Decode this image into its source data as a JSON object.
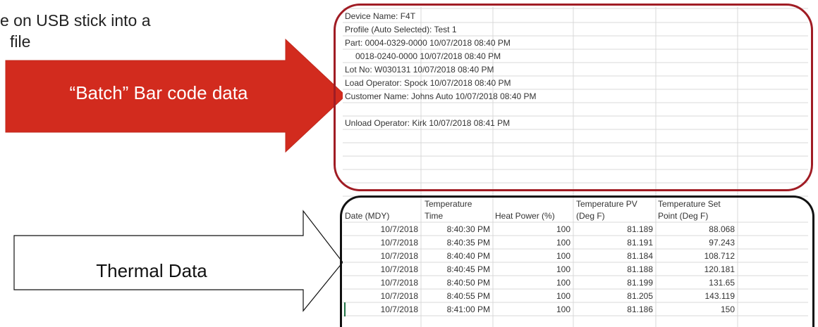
{
  "intro": {
    "line1": "e on USB stick into a",
    "line2": "file"
  },
  "arrows": {
    "batch_label": "“Batch” Bar code data",
    "thermal_label": "Thermal Data",
    "batch_color": "#d22b1e",
    "thermal_color": "#ffffff"
  },
  "batch_section": {
    "lines": [
      "Device Name: F4T",
      "Profile (Auto Selected): Test 1",
      "Part: 0004-0329-0000 10/07/2018 08:40 PM",
      "0018-0240-0000 10/07/2018 08:40 PM",
      "Lot No: W030131 10/07/2018 08:40 PM",
      "Load Operator: Spock 10/07/2018 08:40 PM",
      "Customer Name: Johns Auto 10/07/2018 08:40 PM",
      "",
      "Unload Operator: Kirk 10/07/2018 08:41 PM"
    ],
    "box_color": "#a01c24"
  },
  "thermal_section": {
    "headers": {
      "date": "Date (MDY)",
      "time": "Time",
      "heat_line1": "Temperature",
      "heat_line2": "Heat Power (%)",
      "pv_line1": "Temperature PV",
      "pv_line2": "(Deg F)",
      "sp_line1": "Temperature Set",
      "sp_line2": "Point (Deg F)"
    },
    "rows": [
      {
        "date": "10/7/2018",
        "time": "8:40:30 PM",
        "heat": "100",
        "pv": "81.189",
        "sp": "88.068"
      },
      {
        "date": "10/7/2018",
        "time": "8:40:35 PM",
        "heat": "100",
        "pv": "81.191",
        "sp": "97.243"
      },
      {
        "date": "10/7/2018",
        "time": "8:40:40 PM",
        "heat": "100",
        "pv": "81.184",
        "sp": "108.712"
      },
      {
        "date": "10/7/2018",
        "time": "8:40:45 PM",
        "heat": "100",
        "pv": "81.188",
        "sp": "120.181"
      },
      {
        "date": "10/7/2018",
        "time": "8:40:50 PM",
        "heat": "100",
        "pv": "81.199",
        "sp": "131.65"
      },
      {
        "date": "10/7/2018",
        "time": "8:40:55 PM",
        "heat": "100",
        "pv": "81.205",
        "sp": "143.119"
      },
      {
        "date": "10/7/2018",
        "time": "8:41:00 PM",
        "heat": "100",
        "pv": "81.186",
        "sp": "150"
      }
    ],
    "box_color": "#111111"
  }
}
